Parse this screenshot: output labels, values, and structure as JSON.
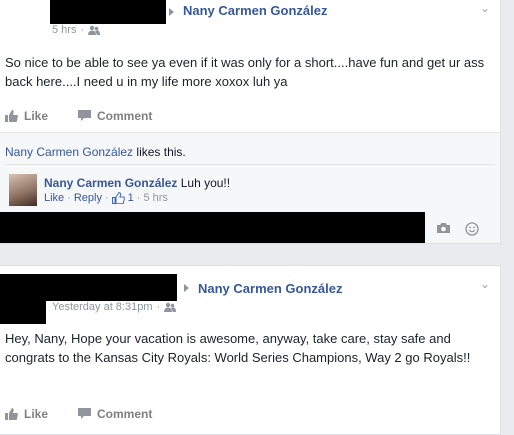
{
  "posts": [
    {
      "author": "Nany Carmen González",
      "time": "5 hrs",
      "text": "So nice to be able to see ya even if it was only for a short....have fun and get ur ass back here....I need u in my life more xoxox luh ya",
      "like_label": "Like",
      "comment_label": "Comment",
      "likes_name": "Nany Carmen González",
      "likes_suffix": " likes this.",
      "comment": {
        "author": "Nany Carmen González",
        "text": "Luh you!!",
        "like_label": "Like",
        "reply_label": "Reply",
        "like_count": "1",
        "time": "5 hrs"
      }
    },
    {
      "author": "Nany Carmen González",
      "time": "Yesterday at 8:31pm",
      "text": "Hey, Nany, Hope your vacation is awesome, anyway, take care, stay safe and congrats to the Kansas City Royals: World Series Champions, Way 2 go Royals!!",
      "like_label": "Like",
      "comment_label": "Comment"
    }
  ],
  "icons": {
    "audience": "friends-icon",
    "like": "thumbs-up-icon",
    "comment": "speech-bubble-icon",
    "camera": "camera-icon",
    "emoji": "smiley-icon",
    "menu": "chevron-down-icon"
  }
}
